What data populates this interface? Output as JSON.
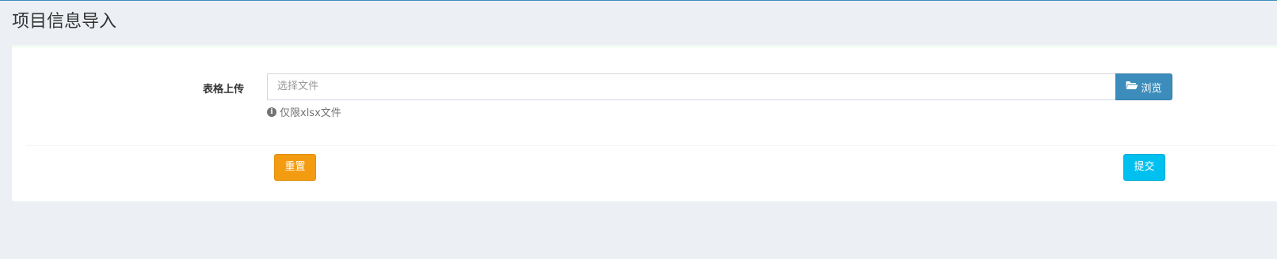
{
  "header": {
    "title": "项目信息导入"
  },
  "form": {
    "upload_label": "表格上传",
    "file_placeholder": "选择文件",
    "browse_label": "浏览",
    "browse_icon": "folder-open-icon",
    "help_icon": "info-circle-icon",
    "help_text": "仅限xlsx文件",
    "reset_label": "重置",
    "submit_label": "提交"
  },
  "colors": {
    "primary": "#3c8dbc",
    "warning": "#f39c12",
    "info": "#00c0ef",
    "background": "#ecf0f5"
  }
}
